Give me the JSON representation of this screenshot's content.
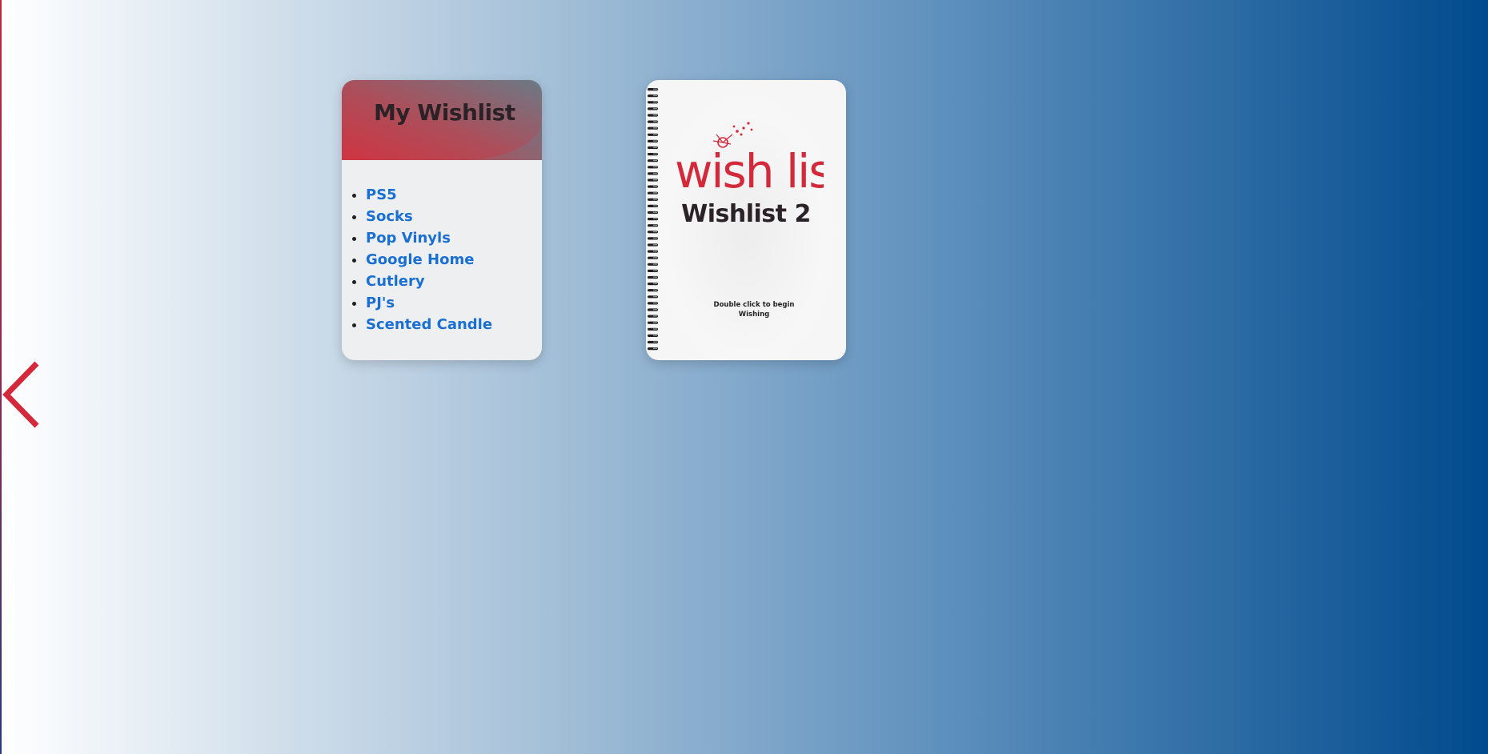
{
  "navigation": {
    "back_icon": "chevron-left-icon",
    "accent_color": "#d3293a"
  },
  "wishlist_card": {
    "title": "My Wishlist",
    "items": [
      "PS5",
      "Socks",
      "Pop Vinyls",
      "Google Home",
      "Cutlery",
      "PJ's",
      "Scented Candle"
    ],
    "link_color": "#1a6fd3"
  },
  "notebook_card": {
    "logo_text": "wish list",
    "title": "Wishlist 2",
    "hint_line1": "Double click to begin",
    "hint_line2": "Wishing",
    "logo_color": "#d3293a"
  }
}
